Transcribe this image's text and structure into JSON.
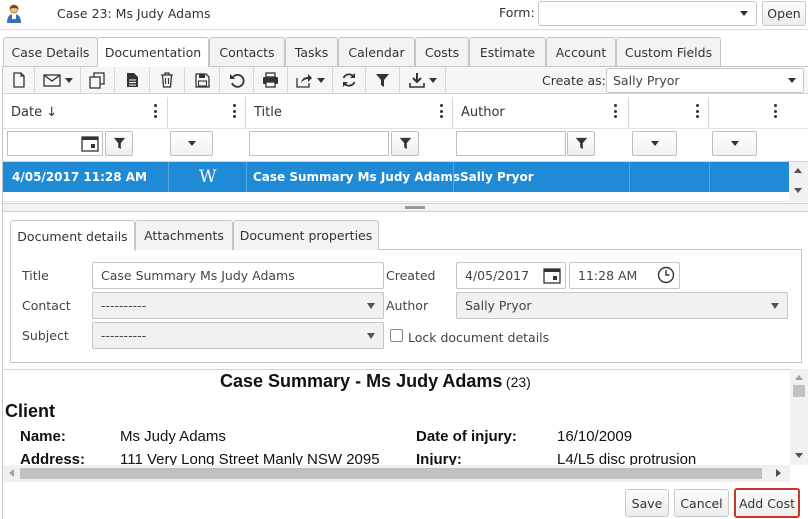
{
  "header": {
    "case_title": "Case 23: Ms Judy Adams",
    "form_label": "Form:",
    "form_value": "",
    "open_label": "Open"
  },
  "tabs": [
    "Case Details",
    "Documentation",
    "Contacts",
    "Tasks",
    "Calendar",
    "Costs",
    "Estimate",
    "Account",
    "Custom Fields"
  ],
  "active_tab": "Documentation",
  "toolbar": {
    "icons": [
      "new-document-icon",
      "email-icon",
      "copy-icon",
      "document-icon",
      "trash-icon",
      "save-icon",
      "undo-icon",
      "print-icon",
      "share-icon",
      "refresh-icon",
      "filter-icon",
      "download-icon"
    ],
    "create_as_label": "Create as:",
    "create_as_value": "Sally Pryor"
  },
  "grid": {
    "columns": [
      "Date ↓",
      "",
      "Title",
      "Author",
      "",
      ""
    ],
    "rows": [
      {
        "date": "4/05/2017 11:28 AM",
        "type": "W",
        "title": "Case Summary Ms Judy Adams",
        "author": "Sally Pryor",
        "selected": true
      }
    ]
  },
  "detail_tabs": [
    "Document details",
    "Attachments",
    "Document properties"
  ],
  "active_detail_tab": "Document details",
  "details": {
    "title_label": "Title",
    "title_value": "Case Summary Ms Judy Adams",
    "contact_label": "Contact",
    "contact_value": "----------",
    "subject_label": "Subject",
    "subject_value": "----------",
    "created_label": "Created",
    "created_date": "4/05/2017",
    "created_time": "11:28 AM",
    "author_label": "Author",
    "author_value": "Sally Pryor",
    "lock_label": "Lock document details"
  },
  "preview": {
    "heading": "Case Summary - Ms Judy Adams",
    "heading_suffix": "(23)",
    "section": "Client",
    "name_label": "Name:",
    "name_value": "Ms Judy Adams",
    "address_label": "Address:",
    "address_value": "111 Very Long Street Manly NSW 2095",
    "doi_label": "Date of injury:",
    "doi_value": "16/10/2009",
    "injury_label": "Injury:",
    "injury_value": "L4/L5 disc protrusion"
  },
  "footer": {
    "save": "Save",
    "cancel": "Cancel",
    "add_cost": "Add Cost"
  },
  "colors": {
    "selected_row": "#1f8ad6",
    "add_cost_border": "#c0392b"
  }
}
